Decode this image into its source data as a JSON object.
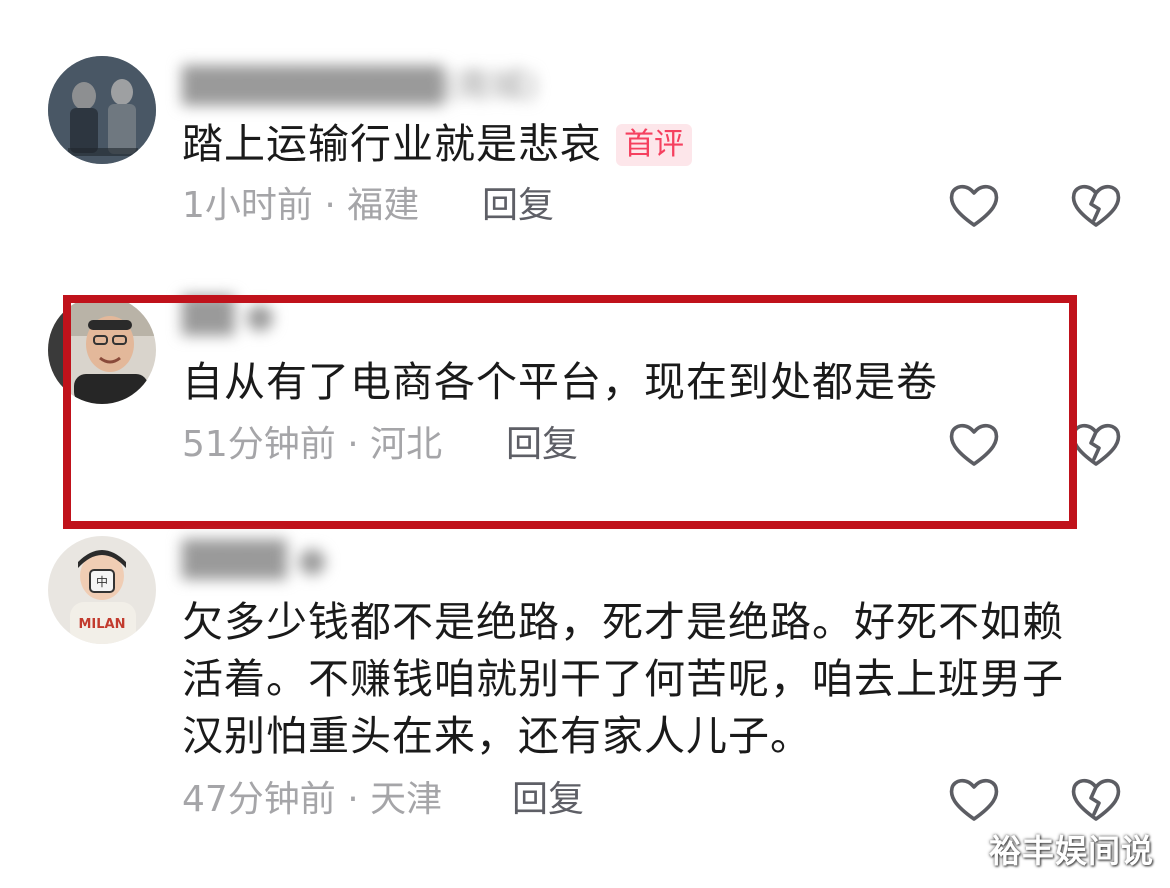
{
  "comments": [
    {
      "text": "踏上运输行业就是悲哀",
      "tag": "首评",
      "meta": "1小时前 · 福建",
      "reply_label": "回复",
      "username_hint": "██████████(南城)"
    },
    {
      "text": "自从有了电商各个平台，现在到处都是卷",
      "meta": "51分钟前 · 河北",
      "reply_label": "回复",
      "username_hint": "██ ●"
    },
    {
      "text": "欠多少钱都不是绝路，死才是绝路。好死不如赖活着。不赚钱咱就别干了何苦呢，咱去上班男子汉别怕重头在来，还有家人儿子。",
      "meta": "47分钟前 · 天津",
      "reply_label": "回复",
      "username_hint": "████ ●"
    }
  ],
  "icons": {
    "like": "heart-outline-icon",
    "dislike": "broken-heart-icon"
  },
  "colors": {
    "highlight_border": "#c0121b",
    "tag_text": "#f5405f",
    "meta_text": "#a5a5a8"
  },
  "watermark": "裕丰娱间说"
}
